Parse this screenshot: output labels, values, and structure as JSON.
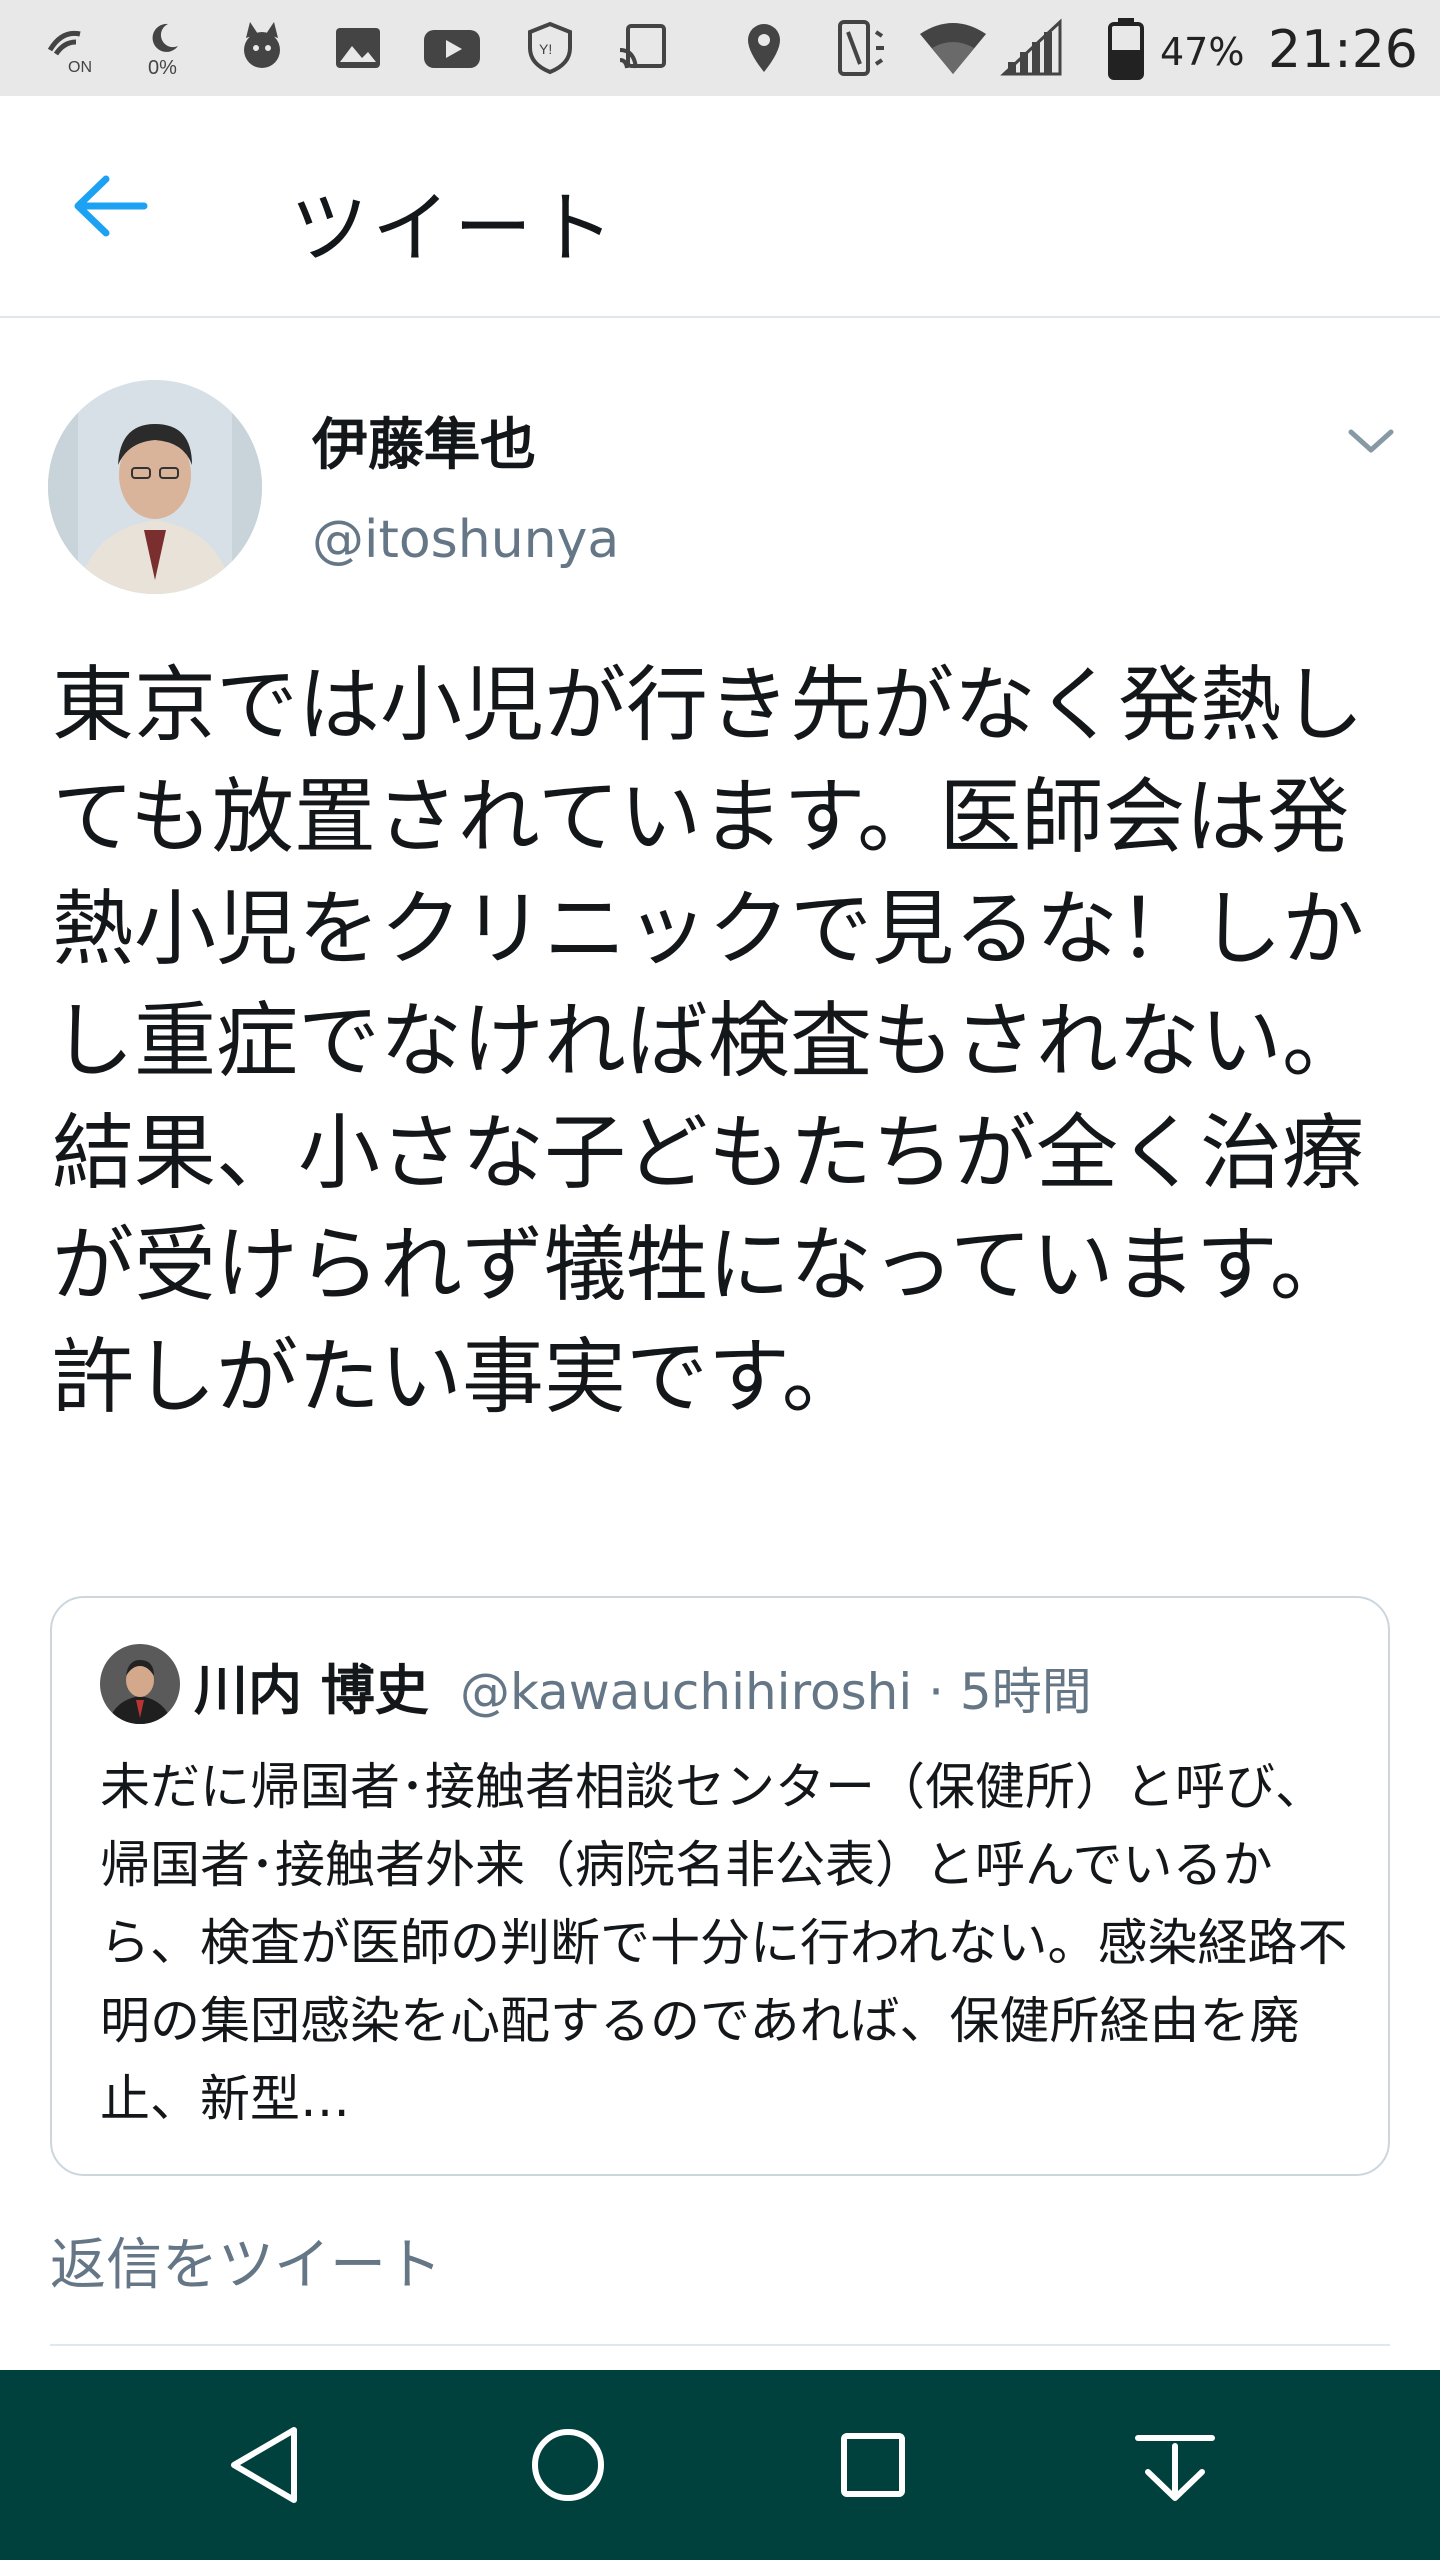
{
  "status_bar": {
    "icons": [
      "volte-on-icon",
      "data-saver-icon",
      "app-notification-icon",
      "image-icon",
      "youtube-icon",
      "vpn-shield-icon",
      "cast-icon",
      "location-icon",
      "vibrate-icon",
      "wifi-icon",
      "cell-signal-icon",
      "battery-icon"
    ],
    "data_saver_label": "0%",
    "battery_percent": "47%",
    "time": "21:26"
  },
  "header": {
    "title": "ツイート",
    "back_icon": "arrow-left-icon"
  },
  "tweet": {
    "author_name": "伊藤隼也",
    "author_handle": "@itoshunya",
    "text": "東京では小児が行き先がなく発熱しても放置されています。医師会は発熱小児をクリニックで見るな！しかし重症でなければ検査もされない。結果、小さな子どもたちが全く治療が受けられず犠牲になっています。許しがたい事実です。"
  },
  "quoted_tweet": {
    "author_name": "川内 博史",
    "author_handle": "@kawauchihiroshi · 5時間",
    "text": "未だに帰国者･接触者相談センター（保健所）と呼び、帰国者･接触者外来（病院名非公表）と呼んでいるから、検査が医師の判断で十分に行われない。感染経路不明の集団感染を心配するのであれば、保健所経由を廃止、新型…"
  },
  "reply": {
    "placeholder": "返信をツイート"
  },
  "colors": {
    "accent": "#1da1f2",
    "nav_bar": "#00403d",
    "secondary_text": "#657786"
  }
}
